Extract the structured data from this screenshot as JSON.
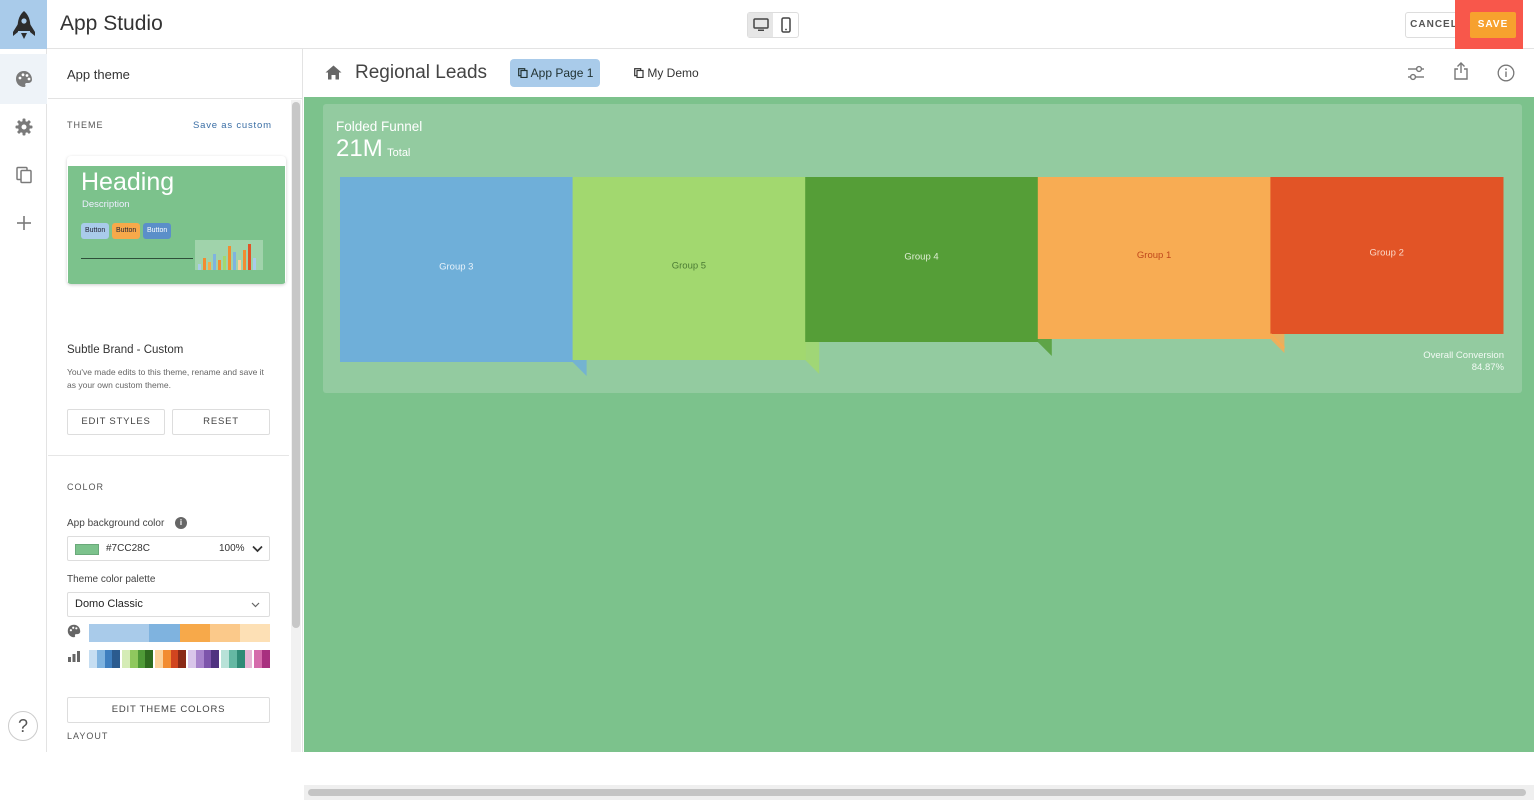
{
  "header": {
    "app_title": "App Studio",
    "cancel_label": "CANCEL",
    "save_label": "SAVE"
  },
  "panel": {
    "title": "App theme",
    "theme_section_label": "THEME",
    "save_as_custom": "Save as custom",
    "preview": {
      "heading": "Heading",
      "description": "Description",
      "buttons": [
        "Button",
        "Button",
        "Button"
      ]
    },
    "theme_name": "Subtle Brand - Custom",
    "theme_note": "You've made edits to this theme, rename and save it as your own custom theme.",
    "edit_styles_label": "EDIT STYLES",
    "reset_label": "RESET",
    "color_section_label": "COLOR",
    "bg_color_label": "App background color",
    "bg_color_value": "#7CC28C",
    "bg_color_opacity": "100%",
    "palette_label": "Theme color palette",
    "palette_value": "Domo Classic",
    "edit_theme_colors_label": "EDIT THEME COLORS",
    "layout_section_label": "LAYOUT",
    "theme_swatches": [
      "#a9cbea",
      "#a9cbea",
      "#7fb3df",
      "#f7a94a",
      "#fbc98a",
      "#fde0b5"
    ],
    "chart_swatches": [
      "#c6def2",
      "#7fb3df",
      "#3f7fbf",
      "#2b5b8f",
      "#d5ecb6",
      "#8fc85e",
      "#4f9a37",
      "#2e6b1f",
      "#fbd19a",
      "#f28c30",
      "#d1451f",
      "#8a2a17",
      "#d9c6ea",
      "#a884cc",
      "#7d55ab",
      "#4f3280",
      "#b8e2d8",
      "#64b8a3",
      "#2f8b76",
      "#e7b5d4",
      "#d56bab",
      "#a8307f"
    ]
  },
  "main": {
    "page_title": "Regional Leads",
    "tabs": [
      {
        "label": "App Page 1",
        "active": true
      },
      {
        "label": "My Demo",
        "active": false
      }
    ]
  },
  "card": {
    "title": "Folded Funnel",
    "total_value": "21M",
    "total_label": "Total"
  },
  "chart_data": {
    "type": "bar",
    "title": "Folded Funnel",
    "categories": [
      "Group 3",
      "Group 5",
      "Group 4",
      "Group 1",
      "Group 2"
    ],
    "values": [
      185,
      183,
      165,
      162,
      157
    ],
    "colors": [
      "#6fafd9",
      "#a2d86f",
      "#559e37",
      "#f8ac53",
      "#e25426"
    ],
    "label_colors": [
      "#e8f2fa",
      "#4a7a33",
      "#dfeed4",
      "#c0481c",
      "#fbd7c7"
    ],
    "footer_label": "Overall Conversion",
    "footer_value": "84.87%"
  },
  "colors": {
    "accent": "#f7a12e",
    "canvas_bg": "#7cc28c",
    "highlight": "#f8574b"
  }
}
